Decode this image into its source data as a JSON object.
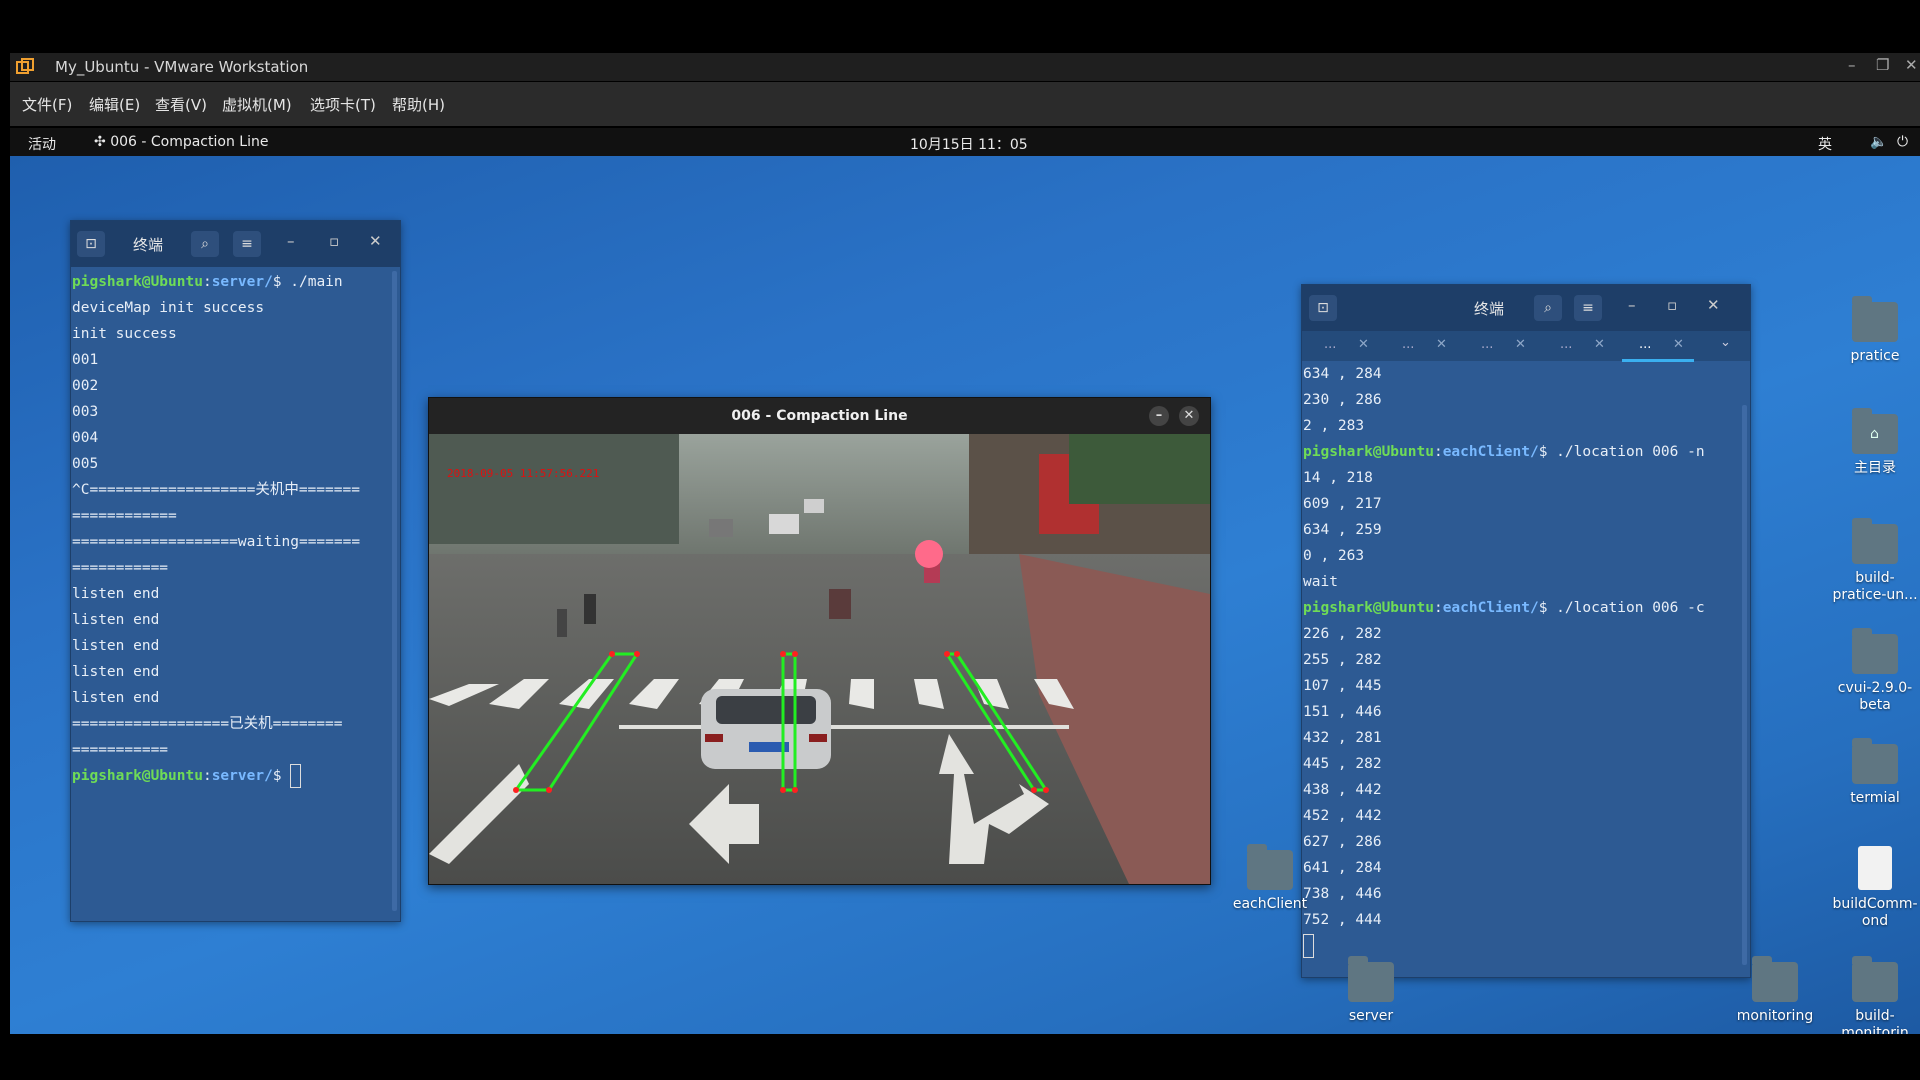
{
  "vmware": {
    "title": "My_Ubuntu - VMware Workstation",
    "menu": [
      "文件(F)",
      "编辑(E)",
      "查看(V)",
      "虚拟机(M)",
      "选项卡(T)",
      "帮助(H)"
    ]
  },
  "topbar": {
    "activities": "活动",
    "app": "006 - Compaction Line",
    "clock": "10月15日  11：05",
    "lang": "英"
  },
  "terminal_left": {
    "title": "终端",
    "lines": [
      {
        "user": "pigshark@Ubuntu",
        "path": "server/",
        "cmd": "$ ./main"
      },
      {
        "text": "deviceMap init success"
      },
      {
        "text": "init success"
      },
      {
        "text": "001"
      },
      {
        "text": "002"
      },
      {
        "text": "003"
      },
      {
        "text": "004"
      },
      {
        "text": "005"
      },
      {
        "text": "^C===================关机中======="
      },
      {
        "text": "============"
      },
      {
        "text": "===================waiting======="
      },
      {
        "text": "==========="
      },
      {
        "text": "listen end"
      },
      {
        "text": "listen end"
      },
      {
        "text": "listen end"
      },
      {
        "text": "listen end"
      },
      {
        "text": "listen end"
      },
      {
        "text": "==================已关机========"
      },
      {
        "text": "==========="
      },
      {
        "user": "pigshark@Ubuntu",
        "path": "server/",
        "cmd": "$ ",
        "cursor": true
      }
    ]
  },
  "image_window": {
    "title": "006 - Compaction Line",
    "overlay_text": [
      "2018-09-05 11:57:56.221"
    ]
  },
  "terminal_right": {
    "title": "终端",
    "tabs": [
      "...",
      "...",
      "...",
      "...",
      "..."
    ],
    "lines": [
      {
        "text": "634 , 284"
      },
      {
        "text": "230 , 286"
      },
      {
        "text": "2 , 283"
      },
      {
        "user": "pigshark@Ubuntu",
        "path": "eachClient/",
        "cmd": "$ ./location 006 -n"
      },
      {
        "text": "14 , 218"
      },
      {
        "text": "609 , 217"
      },
      {
        "text": "634 , 259"
      },
      {
        "text": "0 , 263"
      },
      {
        "text": "wait"
      },
      {
        "user": "pigshark@Ubuntu",
        "path": "eachClient/",
        "cmd": "$ ./location 006 -c"
      },
      {
        "text": "226 , 282"
      },
      {
        "text": "255 , 282"
      },
      {
        "text": "107 , 445"
      },
      {
        "text": "151 , 446"
      },
      {
        "text": "432 , 281"
      },
      {
        "text": "445 , 282"
      },
      {
        "text": "438 , 442"
      },
      {
        "text": "452 , 442"
      },
      {
        "text": "627 , 286"
      },
      {
        "text": "641 , 284"
      },
      {
        "text": "738 , 446"
      },
      {
        "text": "752 , 444"
      },
      {
        "text": "",
        "cursor": true
      }
    ]
  },
  "desktop_icons": [
    {
      "label": "pratice",
      "kind": "folder"
    },
    {
      "label": "主目录",
      "kind": "home"
    },
    {
      "label": "build-pratice-un...",
      "kind": "folder"
    },
    {
      "label": "cvui-2.9.0-beta",
      "kind": "folder"
    },
    {
      "label": "termial",
      "kind": "folder"
    },
    {
      "label": "buildComm-ond",
      "kind": "file"
    },
    {
      "label": "eachClient",
      "kind": "folder"
    },
    {
      "label": "server",
      "kind": "folder"
    },
    {
      "label": "monitoring",
      "kind": "folder"
    },
    {
      "label": "build-monitorin",
      "kind": "folder"
    }
  ],
  "colors": {
    "prompt_user": "#6fdc56",
    "prompt_path": "#79b9ff",
    "lane_line": "#22ee22",
    "lane_vertex": "#ff2020"
  }
}
